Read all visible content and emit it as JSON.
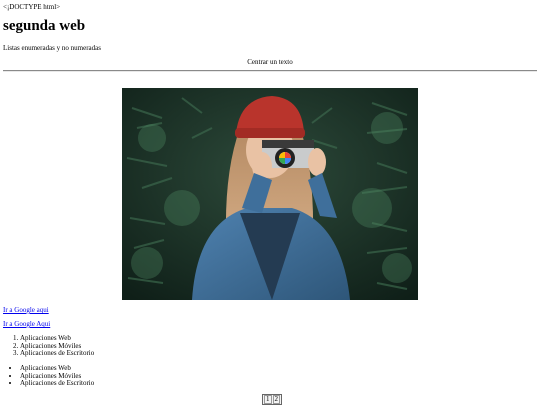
{
  "doctype_text": "<¡DOCTYPE html>",
  "heading": "segunda web",
  "lists_caption": "Listas enumeradas y no numeradas",
  "centered_text": "Centrar un texto",
  "image": {
    "subject": "woman with red beanie holding a camera",
    "colors": {
      "foliage": "#1f3a2e",
      "beanie": "#b9342c",
      "hair": "#c9a07a",
      "jacket": "#3f6f9b",
      "camera": "#c9cbcc"
    }
  },
  "links": [
    {
      "label": "Ir a Google aqui"
    },
    {
      "label": "Ir a Google Aqui"
    }
  ],
  "ordered_list": [
    "Aplicaciones Web",
    "Aplicaciones Móviles",
    "Aplicaciones de Escritorio"
  ],
  "unordered_list": [
    "Aplicaciones Web",
    "Aplicaciones Móviles",
    "Aplicaciones de Escritorio"
  ],
  "pager": [
    "1",
    "2"
  ]
}
